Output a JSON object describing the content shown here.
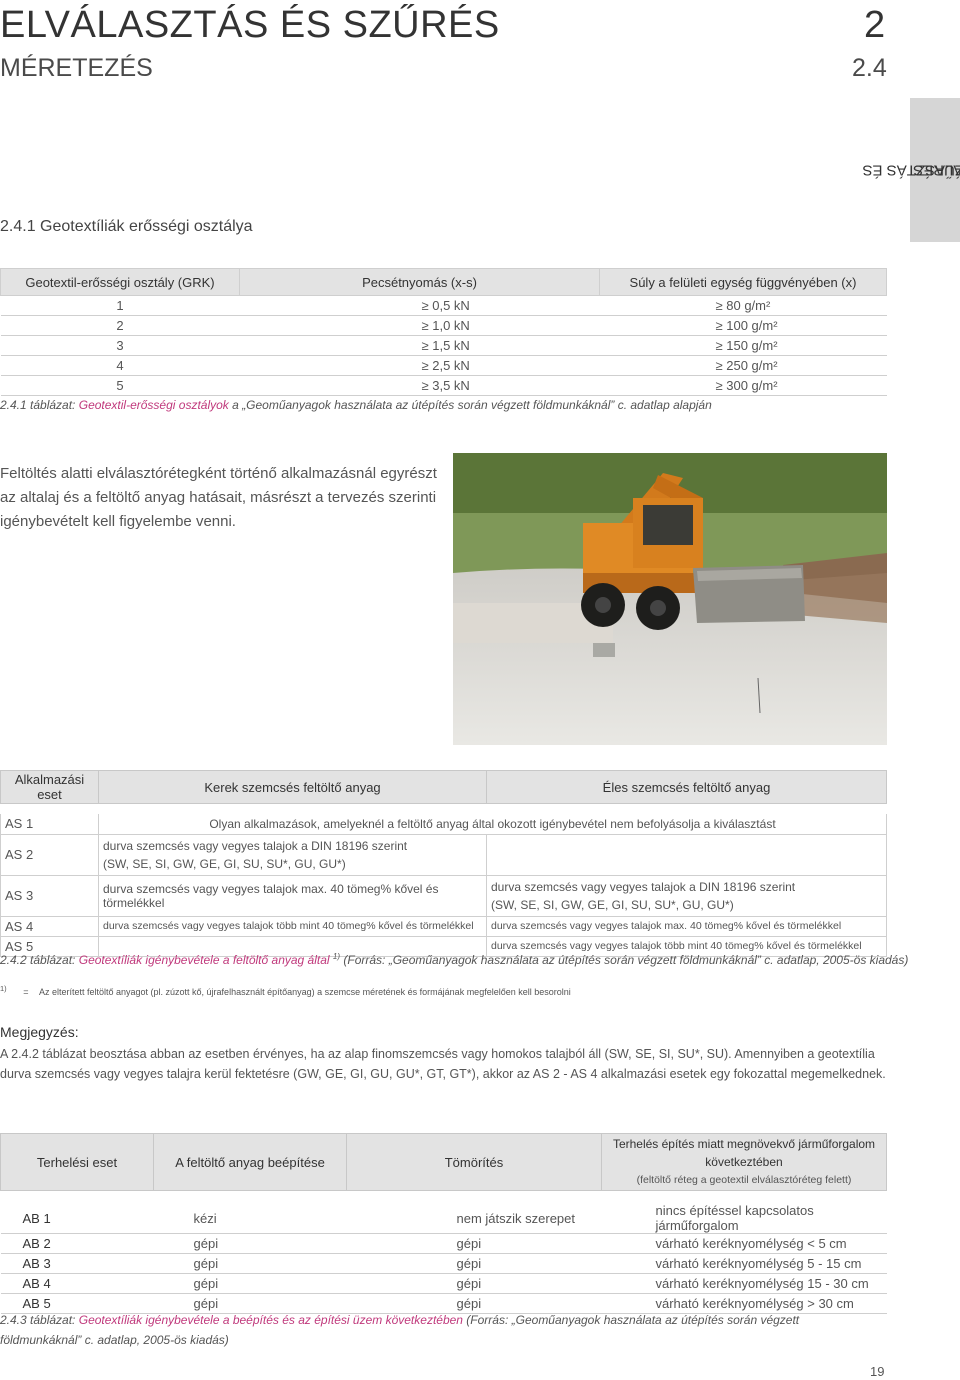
{
  "header": {
    "title": "ELVÁLASZTÁS ÉS SZŰRÉS",
    "chapter_number": "2",
    "subtitle": "MÉRETEZÉS",
    "section_number": "2.4",
    "side_tab_line1": "ELVÁLASZTÁS ÉS",
    "side_tab_line2": "SZŰRÉS"
  },
  "section_title": "2.4.1 Geotextíliák erősségi osztálya",
  "table1": {
    "headers": [
      "Geotextil-erősségi osztály (GRK)",
      "Pecsétnyomás (x-s)",
      "Súly a felületi egység függvényében (x)"
    ],
    "rows": [
      [
        "1",
        "≥ 0,5 kN",
        "≥ 80 g/m²"
      ],
      [
        "2",
        "≥ 1,0 kN",
        "≥ 100 g/m²"
      ],
      [
        "3",
        "≥ 1,5 kN",
        "≥ 150 g/m²"
      ],
      [
        "4",
        "≥ 2,5 kN",
        "≥ 250 g/m²"
      ],
      [
        "5",
        "≥ 3,5 kN",
        "≥ 300 g/m²"
      ]
    ],
    "caption_prefix": "2.4.1 táblázat: ",
    "caption_highlight": "Geotextil-erősségi osztályok",
    "caption_rest": " a „Geoműanyagok használata az útépítés során végzett földmunkáknál” c. adatlap alapján"
  },
  "paragraph": "Feltöltés alatti elválasztórétegként történő alkalmazásnál egyrészt az altalaj és a feltöltő anyag hatásait, másrészt a tervezés szerinti igénybevételt kell figyelembe venni.",
  "table2": {
    "headers": [
      "Alkalmazási eset",
      "Kerek szemcsés feltöltő anyag",
      "Éles szemcsés feltöltő anyag"
    ],
    "as1_label": "AS 1",
    "as1_text": "Olyan alkalmazások, amelyeknél a feltöltő anyag által okozott igénybevétel nem befolyásolja a kiválasztást",
    "as2_label": "AS 2",
    "as2_round_line1": "durva szemcsés vagy vegyes talajok a DIN 18196 szerint",
    "as2_round_line2": "(SW, SE, SI, GW, GE, GI, SU, SU*, GU, GU*)",
    "as3_label": "AS 3",
    "as3_round": "durva szemcsés vagy vegyes talajok max. 40 tömeg% kővel és törmelékkel",
    "as3_sharp_line1": "durva szemcsés vagy vegyes talajok a DIN 18196 szerint",
    "as3_sharp_line2": "(SW, SE, SI, GW, GE, GI, SU, SU*, GU, GU*)",
    "as4_label": "AS 4",
    "as4_round": "durva szemcsés vagy vegyes talajok több mint 40 tömeg% kővel és törmelékkel",
    "as4_sharp": "durva szemcsés vagy vegyes talajok max. 40 tömeg% kővel és törmelékkel",
    "as5_label": "AS 5",
    "as5_sharp": "durva szemcsés vagy vegyes talajok több mint 40 tömeg% kővel és törmelékkel",
    "caption_prefix": "2.4.2 táblázat: ",
    "caption_highlight": "Geotextíliák igénybevétele a feltöltő anyag által",
    "caption_sup": "1)",
    "caption_rest": " (Forrás: „Geoműanyagok használata az útépítés során végzett földmunkáknál” c. adatlap, 2005-ös kiadás)"
  },
  "footnote": {
    "mark": "1)",
    "eq": "=",
    "text": "Az elterített feltöltő anyagot (pl. zúzott kő, újrafelhasznált építőanyag) a szemcse méretének és formájának megfelelően kell besorolni"
  },
  "note": {
    "heading": "Megjegyzés:",
    "text": "A 2.4.2 táblázat beosztása abban az esetben érvényes, ha az alap finomszemcsés vagy homokos talajból áll (SW, SE, SI, SU*, SU). Amennyiben a geotextília durva szemcsés vagy vegyes talajra kerül fektetésre (GW, GE, GI, GU, GU*, GT, GT*), akkor az AS 2 - AS 4 alkalmazási esetek egy fokozattal megemelkednek."
  },
  "table3": {
    "headers": [
      "Terhelési eset",
      "A feltöltő anyag beépítése",
      "Tömörítés"
    ],
    "header4_line1": "Terhelés építés miatt megnövekvő járműforgalom következtében",
    "header4_line2": "(feltöltő réteg a geotextil elválasztóréteg felett)",
    "rows": [
      [
        "AB 1",
        "kézi",
        "nem játszik szerepet",
        "nincs építéssel kapcsolatos járműforgalom"
      ],
      [
        "AB 2",
        "gépi",
        "gépi",
        "várható keréknyomélység < 5 cm"
      ],
      [
        "AB 3",
        "gépi",
        "gépi",
        "várható keréknyomélység 5 - 15 cm"
      ],
      [
        "AB 4",
        "gépi",
        "gépi",
        "várható keréknyomélység 15 - 30 cm"
      ],
      [
        "AB 5",
        "gépi",
        "gépi",
        "várható keréknyomélység > 30 cm"
      ]
    ],
    "caption_prefix": "2.4.3 táblázat: ",
    "caption_highlight": "Geotextíliák igénybevétele a beépítés és az építési üzem következtében",
    "caption_rest": " (Forrás: „Geoműanyagok használata az útépítés során végzett földmunkáknál” c. adatlap, 2005-ös kiadás)"
  },
  "page_number": "19",
  "colors": {
    "accent": "#c0397c",
    "header_bg": "#e3e3e3",
    "tab_bg": "#d6d6d6"
  },
  "photo": {
    "subject": "orange wheeled excavator with dozer blade on geotextile-covered ground"
  }
}
